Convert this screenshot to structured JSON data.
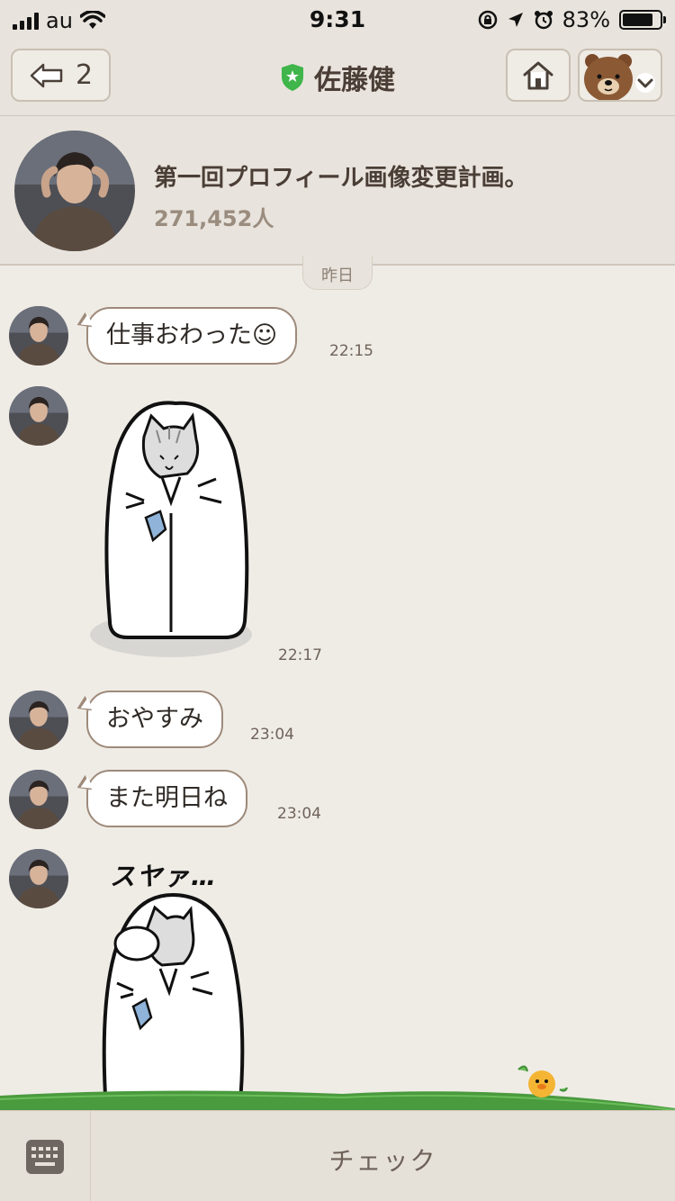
{
  "status_bar": {
    "carrier": "au",
    "time": "9:31",
    "battery_percent": "83%",
    "battery_level": 0.83
  },
  "nav": {
    "back_count": "2",
    "title": "佐藤健"
  },
  "profile": {
    "status_message": "第一回プロフィール画像変更計画。",
    "friend_count": "271,452人"
  },
  "date_divider": "昨日",
  "messages": [
    {
      "type": "text",
      "text": "仕事おわった☺",
      "time": "22:15"
    },
    {
      "type": "sticker",
      "time": "22:17"
    },
    {
      "type": "text",
      "text": "おやすみ",
      "time": "23:04"
    },
    {
      "type": "text",
      "text": "また明日ね",
      "time": "23:04"
    },
    {
      "type": "sticker",
      "caption": "スヤァ…"
    }
  ],
  "footer": {
    "check_label": "チェック"
  },
  "icons": [
    "back-arrow-icon",
    "shield-icon",
    "home-icon",
    "brown-bear-icon",
    "chevron-down-icon",
    "keyboard-icon",
    "sally-chick-icon"
  ],
  "colors": {
    "background": "#efece6",
    "header": "#e8e3dc",
    "bubble_border": "#9e8a7a",
    "official_green": "#3fb54a",
    "grass": "#4a9a3e"
  }
}
